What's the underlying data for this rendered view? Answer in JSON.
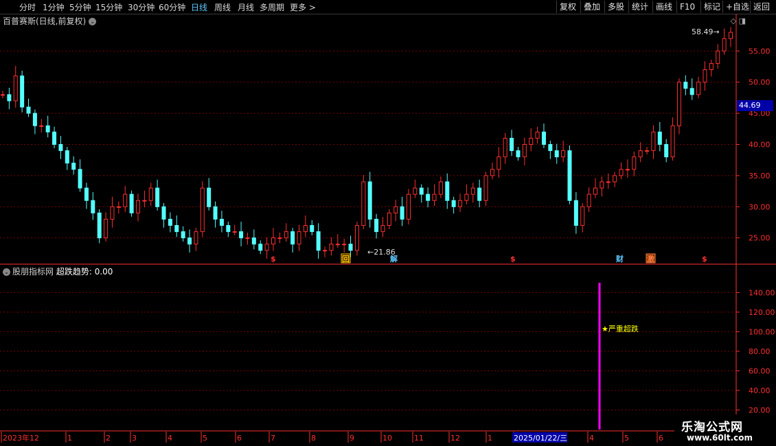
{
  "toolbar": {
    "periods": [
      "分时",
      "1分钟",
      "5分钟",
      "15分钟",
      "30分钟",
      "60分钟",
      "日线",
      "周线",
      "月线",
      "多周期",
      "更多 >"
    ],
    "active_period": "日线",
    "actions": [
      "复权",
      "叠加",
      "多股",
      "统计",
      "画线",
      "F10",
      "标记",
      "+自选",
      "返回"
    ]
  },
  "main_title": "百普赛斯(日线,前复权)",
  "price_axis": [
    "55.00",
    "50.00",
    "45.00",
    "40.00",
    "35.00",
    "30.00",
    "25.00"
  ],
  "current_price_tag": "44.69",
  "high_label": "58.49",
  "low_label": "21.86",
  "event_markers": [
    "$",
    "回",
    "解",
    "$",
    "财",
    "激",
    "$"
  ],
  "indicator": {
    "name": "股朋指标网",
    "series_label": "超跌趋势:",
    "series_value": "0.00",
    "axis": [
      "140.00",
      "120.00",
      "100.00",
      "80.00",
      "60.00",
      "40.00",
      "20.00"
    ],
    "signal_label": "★严重超跌",
    "signal_color": "#ff00ff"
  },
  "date_axis": [
    "2023年12",
    "1",
    "2",
    "3",
    "4",
    "5",
    "6",
    "7",
    "8",
    "9",
    "10",
    "11",
    "12",
    "1",
    "2025/01/22/三",
    "4",
    "5",
    "6"
  ],
  "watermark": {
    "title": "乐淘公式网",
    "url": "www.60lt.com"
  },
  "colors": {
    "up": "#ff3030",
    "down": "#54ffff",
    "grid": "#7a0000",
    "axis": "#ff3030",
    "active": "#5fc8ff"
  },
  "chart_data": {
    "type": "candlestick",
    "title": "百普赛斯(日线,前复权)",
    "ylim": [
      21,
      59
    ],
    "y_ticks": [
      25,
      30,
      35,
      40,
      45,
      50,
      55
    ],
    "max_price": 58.49,
    "min_price": 21.86,
    "last_price": 44.69,
    "closes": [
      48,
      47,
      51,
      46,
      45,
      43,
      43,
      42,
      40,
      39,
      37,
      36,
      33,
      31,
      29,
      25,
      28,
      30,
      30,
      32,
      29,
      31,
      31,
      33,
      30,
      28,
      27,
      26,
      25,
      24,
      26,
      33,
      30,
      28,
      27,
      26,
      26,
      25,
      25,
      24,
      23,
      24,
      25,
      25,
      26,
      24,
      26,
      27,
      26,
      23,
      23,
      24,
      24,
      24,
      23,
      27,
      34,
      28,
      26,
      27,
      29,
      30,
      28,
      32,
      33,
      32,
      31,
      32,
      34,
      31,
      30,
      31,
      32,
      33,
      31,
      35,
      36,
      38,
      41,
      39,
      38,
      40,
      41,
      42,
      40,
      39,
      38,
      39,
      31,
      27,
      30,
      32,
      33,
      34,
      34,
      35,
      36,
      36,
      38,
      39,
      39,
      42,
      40,
      38,
      43,
      50,
      49,
      48,
      50,
      52,
      53,
      55,
      57,
      58
    ],
    "subchart": {
      "name": "超跌趋势",
      "ylim": [
        0,
        155
      ],
      "y_ticks": [
        20,
        40,
        60,
        80,
        100,
        120,
        140
      ],
      "current_value": 0.0,
      "signal": {
        "label": "严重超跌",
        "value": 150,
        "date_position": "2025-01 end"
      }
    }
  }
}
